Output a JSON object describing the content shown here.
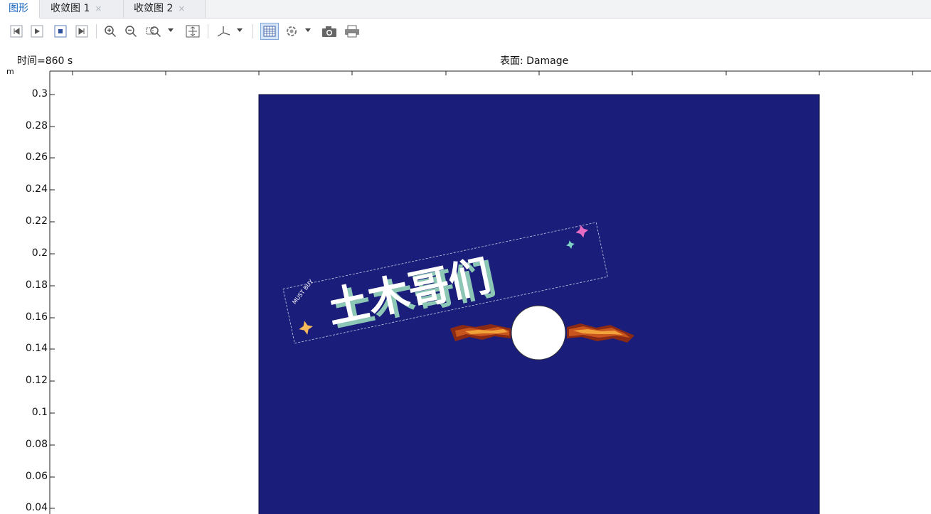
{
  "tabs": [
    {
      "label": "图形",
      "active": true,
      "closable": false
    },
    {
      "label": "收敛图 1",
      "active": false,
      "closable": true,
      "close_glyph": "×"
    },
    {
      "label": "收敛图 2",
      "active": false,
      "closable": true,
      "close_glyph": "×"
    }
  ],
  "toolbar": {
    "buttons": [
      "first-frame-icon",
      "play-icon",
      "stop-icon",
      "last-frame-icon",
      "zoom-in-icon",
      "zoom-out-icon",
      "zoom-box-icon",
      "zoom-extents-icon",
      "axis-orientation-icon",
      "grid-icon",
      "scene-light-icon",
      "camera-icon",
      "print-icon"
    ]
  },
  "plot": {
    "time_label": "时间=860 s",
    "title": "表面: Damage",
    "y_unit": "m",
    "y_ticks": [
      "0.3",
      "0.28",
      "0.26",
      "0.24",
      "0.22",
      "0.2",
      "0.18",
      "0.16",
      "0.14",
      "0.12",
      "0.1",
      "0.08",
      "0.06",
      "0.04"
    ],
    "colors": {
      "domain_fill": "#1a1d7a",
      "hole_fill": "#ffffff",
      "crack_outer": "#8b2a14",
      "crack_mid": "#c8541e",
      "crack_hot": "#f2a23a"
    }
  },
  "watermark": {
    "text": "土木哥们",
    "subtext": "MUST BUY"
  }
}
